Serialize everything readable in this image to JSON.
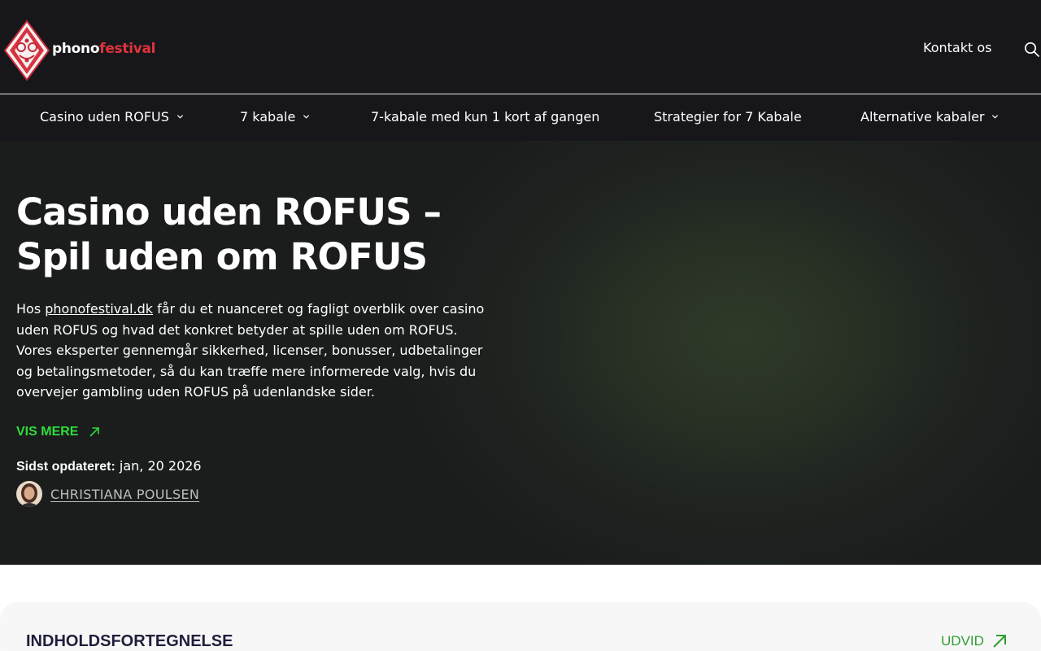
{
  "header": {
    "logo_part1": "phono",
    "logo_part2": "festival",
    "contact_label": "Kontakt os"
  },
  "nav": {
    "items": [
      {
        "label": "Casino uden ROFUS"
      },
      {
        "label": "7 kabale"
      },
      {
        "label": "7-kabale med kun 1 kort af gangen"
      },
      {
        "label": "Strategier for 7 Kabale"
      },
      {
        "label": "Alternative kabaler"
      }
    ]
  },
  "hero": {
    "title": "Casino uden ROFUS – Spil uden om ROFUS",
    "intro_prefix": "Hos ",
    "intro_link": "phonofestival.dk",
    "intro_rest": " får du et nuanceret og fagligt overblik over casino uden ROFUS og hvad det konkret betyder at spille uden om ROFUS. Vores eksperter gennemgår sikkerhed, licenser, bonusser, udbetalinger og betalingsmetoder, så du kan træffe mere informerede valg, hvis du overvejer gambling uden ROFUS på udenlandske sider.",
    "vis_mere": "VIS MERE",
    "updated_label": "Sidst opdateret:",
    "updated_value": " jan, 20 2026",
    "author": "CHRISTIANA POULSEN"
  },
  "toc": {
    "title": "INDHOLDSFORTEGNELSE",
    "expand_label": "UDVID"
  },
  "colors": {
    "header_bg": "#17171b",
    "accent_green": "#2fdc3c",
    "logo_red": "#e0333a",
    "toc_green": "#2f9f33"
  }
}
